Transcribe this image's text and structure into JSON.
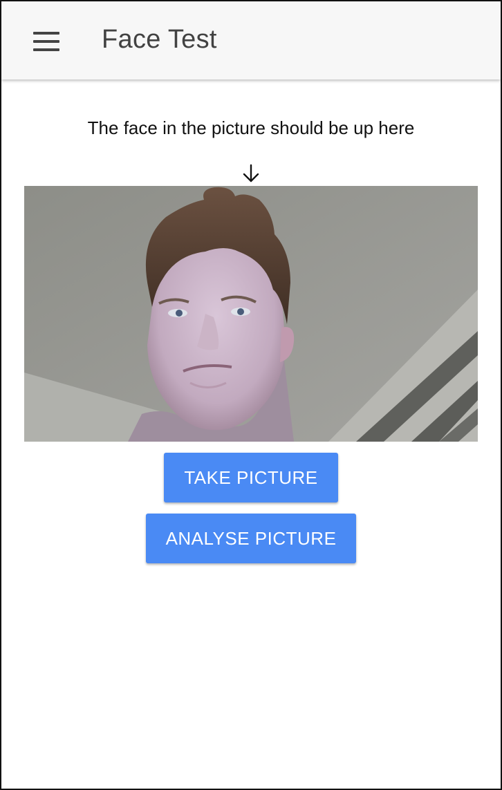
{
  "app_bar": {
    "title": "Face Test",
    "menu_icon": "hamburger-menu-icon"
  },
  "main": {
    "instruction": "The face in the picture should be up here",
    "arrow_icon": "arrow-down-icon",
    "photo": "webcam-face-photo",
    "take_picture_label": "TAKE PICTURE",
    "analyse_picture_label": "ANALYSE PICTURE"
  },
  "colors": {
    "app_bar_bg": "#f7f7f7",
    "title_text": "#424242",
    "button_bg": "#4a8af4",
    "button_text": "#ffffff"
  }
}
